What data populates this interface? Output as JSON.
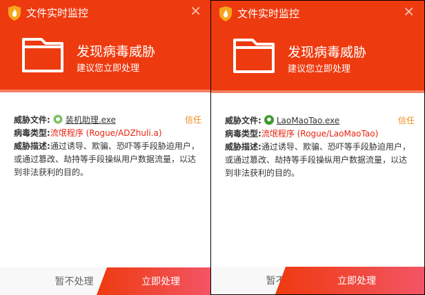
{
  "colors": {
    "header": "#ee3a0f",
    "accent_red": "#e8230f",
    "trust": "#f08a1a"
  },
  "windows": [
    {
      "title": "文件实时监控",
      "heading": "发现病毒威胁",
      "subheading": "建议您立即处理",
      "file_label": "威胁文件:",
      "file_name": "装机助理.exe",
      "file_icon": "gear-icon",
      "trust": "信任",
      "type_label": "病毒类型:",
      "type_value": "流氓程序 (Rogue/ADZhuli.a)",
      "desc_label": "威胁描述:",
      "desc_value": "通过诱导、欺骗、恐吓等手段胁迫用户，或通过篡改、劫持等手段操纵用户数据流量，以达到非法获利的目的。",
      "later": "暂不处理",
      "now": "立即处理"
    },
    {
      "title": "文件实时监控",
      "heading": "发现病毒威胁",
      "subheading": "建议您立即处理",
      "file_label": "威胁文件:",
      "file_name": "LaoMaoTao.exe",
      "file_icon": "usb-drive-icon",
      "trust": "信任",
      "type_label": "病毒类型:",
      "type_value": "流氓程序 (Rogue/LaoMaoTao)",
      "desc_label": "威胁描述:",
      "desc_value": "通过诱导、欺骗、恐吓等手段胁迫用户，或通过篡改、劫持等手段操纵用户数据流量，以达到非法获利的目的。",
      "later": "暂不处理",
      "now": "立即处理"
    }
  ]
}
